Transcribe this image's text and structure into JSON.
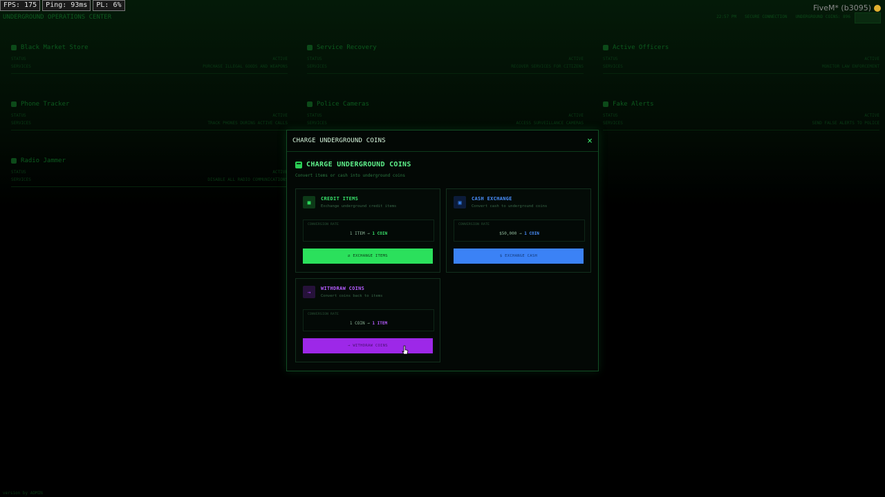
{
  "perf": {
    "fps": "FPS: 175",
    "ping": "Ping: 93ms",
    "pl": "PL: 6%"
  },
  "fivem": {
    "label": "FiveM* (b3095)"
  },
  "dashboard": {
    "title": "UNDERGROUND OPERATIONS CENTER",
    "status": [
      "22:57 PM",
      "SECURE CONNECTION",
      "UNDERGROUND COINS: 896"
    ],
    "cards": [
      {
        "title": "Black Market Store",
        "status_label": "STATUS",
        "status": "ACTIVE",
        "desc_label": "SERVICES",
        "desc": "PURCHASE ILLEGAL GOODS AND WEAPONS"
      },
      {
        "title": "Service Recovery",
        "status_label": "STATUS",
        "status": "ACTIVE",
        "desc_label": "SERVICES",
        "desc": "RECOVER SERVICES FOR CITIZENS"
      },
      {
        "title": "Active Officers",
        "status_label": "STATUS",
        "status": "ACTIVE",
        "desc_label": "SERVICES",
        "desc": "MONITOR LAW ENFORCEMENT"
      },
      {
        "title": "Phone Tracker",
        "status_label": "STATUS",
        "status": "ACTIVE",
        "desc_label": "SERVICES",
        "desc": "TRACK PHONES DURING ACTIVE CALLS"
      },
      {
        "title": "Police Cameras",
        "status_label": "STATUS",
        "status": "ACTIVE",
        "desc_label": "SERVICES",
        "desc": "ACCESS SURVEILLANCE CAMERAS"
      },
      {
        "title": "Fake Alerts",
        "status_label": "STATUS",
        "status": "ACTIVE",
        "desc_label": "SERVICES",
        "desc": "SEND FALSE ALERTS TO POLICE"
      },
      {
        "title": "Radio Jammer",
        "status_label": "STATUS",
        "status": "ACTIVE",
        "desc_label": "SERVICES",
        "desc": "DISABLE ALL RADIO COMMUNICATIONS"
      }
    ],
    "footer": "version by ADMIN"
  },
  "modal": {
    "title": "CHARGE UNDERGROUND COINS",
    "close_label": "×",
    "heading": "CHARGE UNDERGROUND COINS",
    "subheading": "Convert items or cash into underground coins",
    "cards": [
      {
        "id": "credit",
        "icon": "■",
        "title": "CREDIT ITEMS",
        "subtitle": "Exchange underground credit items",
        "rate_label": "CONVERSION RATE",
        "rate_left": "1 ITEM →",
        "rate_right": "1 COIN",
        "button": "⇄ EXCHANGE ITEMS"
      },
      {
        "id": "cash",
        "icon": "▣",
        "title": "CASH EXCHANGE",
        "subtitle": "Convert cash to underground coins",
        "rate_label": "CONVERSION RATE",
        "rate_left": "$50,000 →",
        "rate_right": "1 COIN",
        "button": "$ EXCHANGE CASH"
      },
      {
        "id": "withdraw",
        "icon": "→",
        "title": "WITHDRAW COINS",
        "subtitle": "Convert coins back to items",
        "rate_label": "CONVERSION RATE",
        "rate_left": "1 COIN →",
        "rate_right": "1 ITEM",
        "button": "→ WITHDRAW COINS"
      }
    ]
  },
  "colors": {
    "green": "#2be05c",
    "blue": "#3b82f6",
    "purple": "#9d28e8",
    "background": "#000000"
  }
}
